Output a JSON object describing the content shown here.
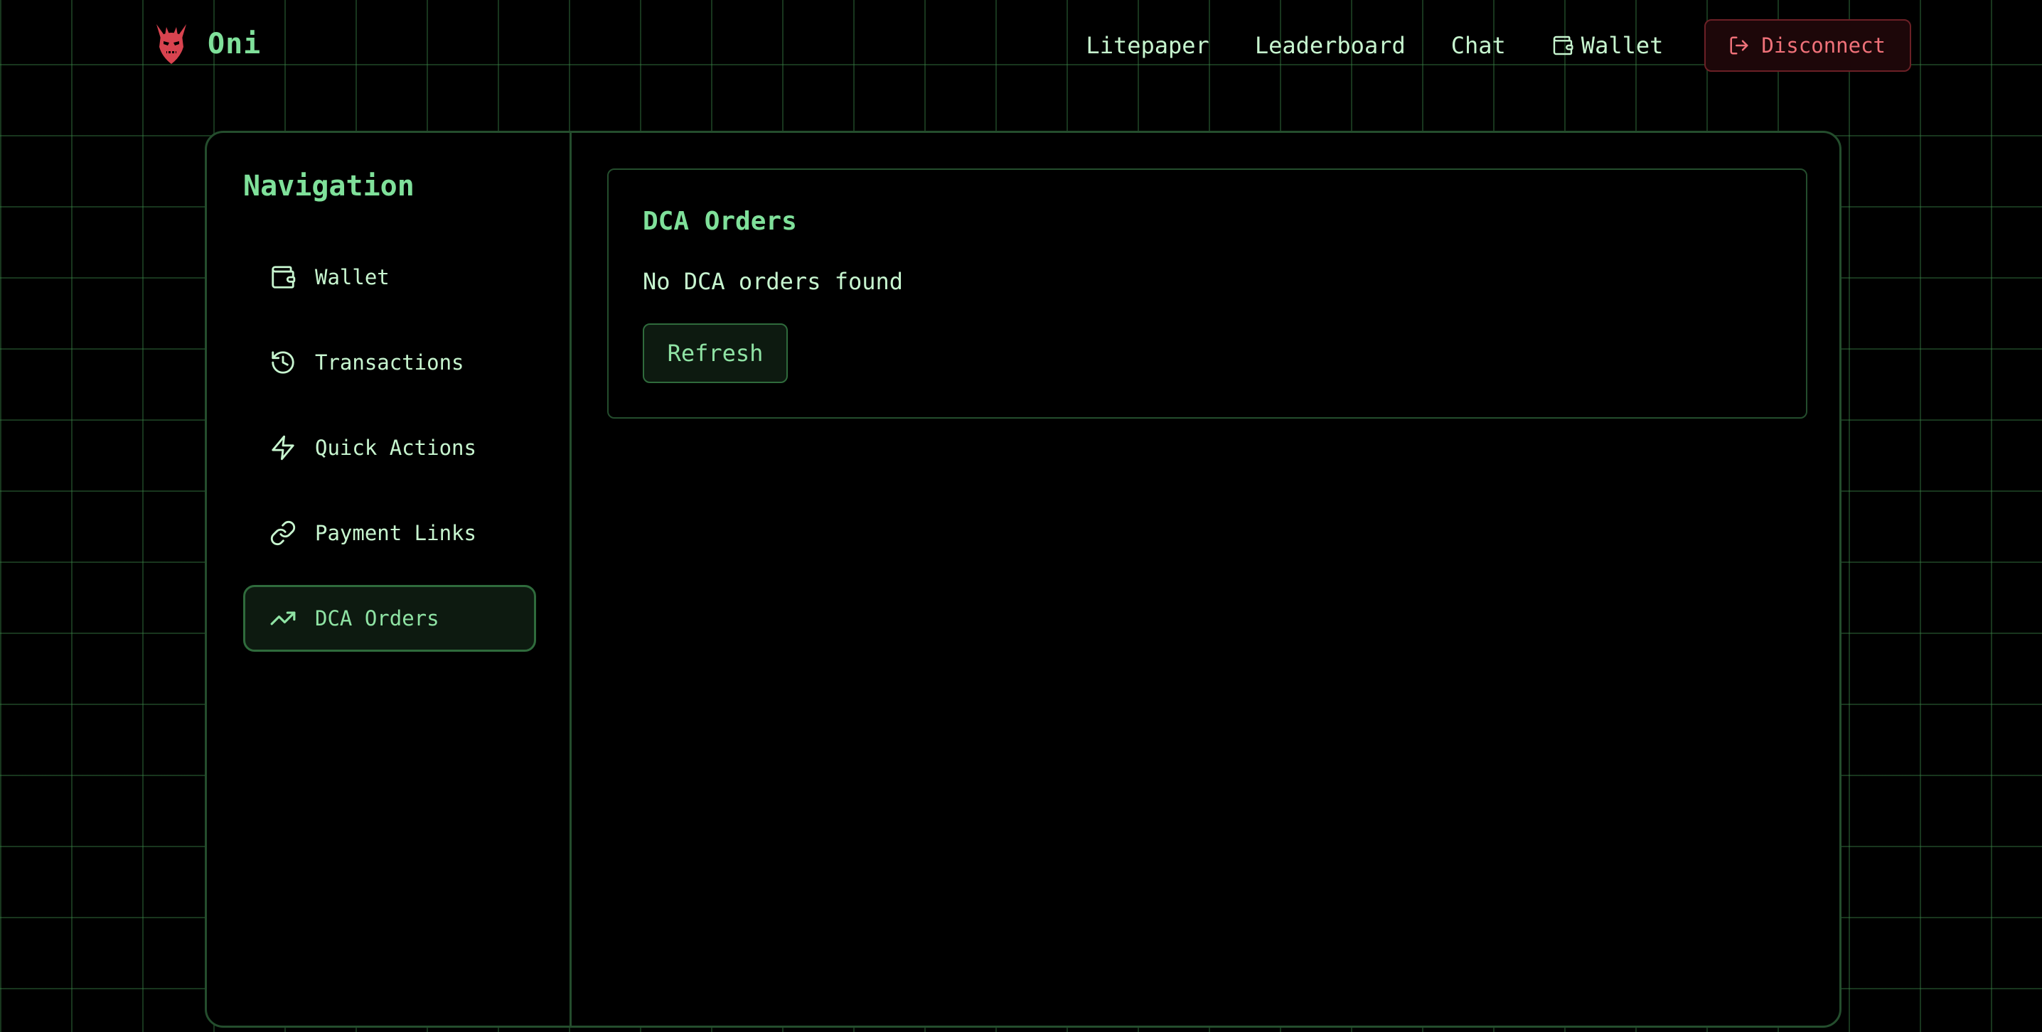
{
  "brand": {
    "name": "Oni",
    "logo_icon": "oni-demon-mask-icon"
  },
  "topnav": {
    "links": [
      {
        "label": "Litepaper"
      },
      {
        "label": "Leaderboard"
      },
      {
        "label": "Chat"
      },
      {
        "label": "Wallet",
        "icon": "wallet-icon"
      }
    ],
    "disconnect": {
      "label": "Disconnect",
      "icon": "log-out-icon"
    }
  },
  "sidebar": {
    "title": "Navigation",
    "items": [
      {
        "label": "Wallet",
        "icon": "wallet-icon",
        "active": false
      },
      {
        "label": "Transactions",
        "icon": "history-icon",
        "active": false
      },
      {
        "label": "Quick Actions",
        "icon": "lightning-bolt-icon",
        "active": false
      },
      {
        "label": "Payment Links",
        "icon": "link-icon",
        "active": false
      },
      {
        "label": "DCA Orders",
        "icon": "trending-up-icon",
        "active": true
      }
    ]
  },
  "main": {
    "card": {
      "title": "DCA Orders",
      "empty_message": "No DCA orders found",
      "refresh_label": "Refresh"
    }
  },
  "colors": {
    "background": "#000000",
    "grid_line": "#1f4a28",
    "accent_green": "#7fe09a",
    "text": "#c7f5cf",
    "panel_border": "#244d2d",
    "danger": "#f07179",
    "danger_bg": "#1d0709"
  }
}
